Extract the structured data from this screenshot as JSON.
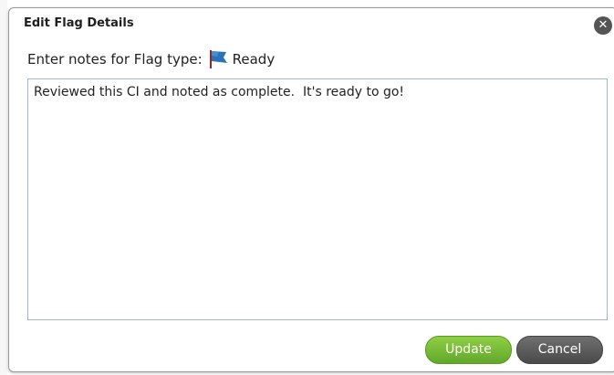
{
  "dialog": {
    "title": "Edit Flag Details",
    "close_icon": "close-icon",
    "prompt": "Enter notes for Flag type:",
    "flag_icon": "flag-icon",
    "flag_color": "#2a73b8",
    "flag_label": "Ready",
    "notes_value": "Reviewed this CI and noted as complete.  It's ready to go!",
    "buttons": {
      "update": "Update",
      "cancel": "Cancel"
    },
    "colors": {
      "update_button": "#77bb33",
      "cancel_button": "#555555"
    }
  }
}
